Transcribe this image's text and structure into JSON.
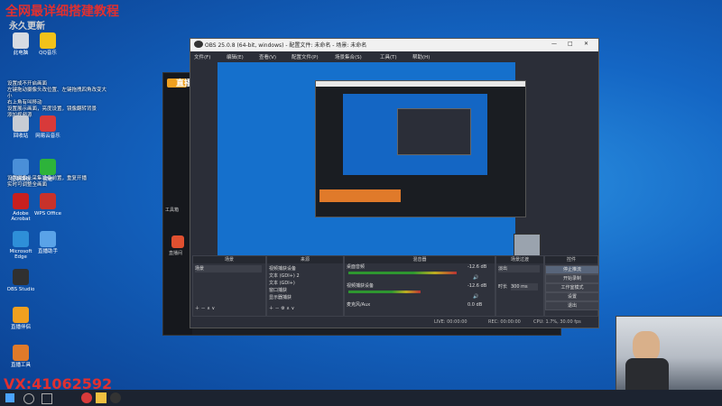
{
  "overlay": {
    "top_left_red": "全网最详细搭建教程",
    "top_left_sub": "永久更新",
    "bottom_left_red": "VX:41062592",
    "notes": [
      "设置成不开启画面",
      "左键拖动摄像头改位置、左键拖拽四角改变大小",
      "右上角有叫移动",
      "设置展示画面，亮度设置，镜像翻转背景",
      "添加视频源"
    ],
    "notes2": [
      "设置摄像头采集设备前置，重复开播",
      "实时可调整全画面"
    ]
  },
  "desktop_icons": [
    {
      "label": "此电脑",
      "color": "#d7dbe2"
    },
    {
      "label": "QQ音乐",
      "color": "#f2c21a"
    },
    {
      "label": "回收站",
      "color": "#c7ccd4"
    },
    {
      "label": "网易云音乐",
      "color": "#d83a3a"
    },
    {
      "label": "控制面板",
      "color": "#4a8fd8"
    },
    {
      "label": "微信",
      "color": "#2db33a"
    },
    {
      "label": "Adobe Acrobat",
      "color": "#c8201f"
    },
    {
      "label": "WPS Office",
      "color": "#c8322a"
    },
    {
      "label": "Microsoft Edge",
      "color": "#2e8fd8"
    },
    {
      "label": "直播助手",
      "color": "#5aa3e8"
    },
    {
      "label": "OBS Studio",
      "color": "#303030"
    },
    {
      "label": "直播伴侣",
      "color": "#f0a020"
    },
    {
      "label": "直播工具",
      "color": "#e07a2a"
    }
  ],
  "obs": {
    "title": "OBS 25.0.8 (64-bit, windows) - 配置文件: 未命名 - 场景: 未命名",
    "menu": [
      "文件(F)",
      "编辑(E)",
      "查看(V)",
      "配置文件(P)",
      "场景集合(S)",
      "工具(T)",
      "帮助(H)"
    ],
    "docks": {
      "scenes": {
        "header": "场景",
        "items": [
          "场景"
        ]
      },
      "sources": {
        "header": "来源",
        "items": [
          "视频捕获设备",
          "文本 (GDI+) 2",
          "文本 (GDI+)",
          "窗口捕获",
          "显示器捕获"
        ]
      },
      "mixer": {
        "header": "混音器",
        "tracks": [
          {
            "name": "桌面音频",
            "db": "-12.6 dB"
          },
          {
            "name": "视频捕获设备",
            "db": "-12.6 dB"
          },
          {
            "name": "麦克风/Aux",
            "db": "0.0 dB"
          }
        ]
      },
      "transitions": {
        "header": "场景过渡",
        "type": "淡出",
        "duration_label": "时长",
        "duration_value": "300 ms"
      },
      "controls": {
        "header": "控件",
        "buttons": [
          "停止推流",
          "开始录制",
          "工作室模式",
          "设置",
          "退出"
        ]
      }
    },
    "status": {
      "live": "LIVE: 00:00:00",
      "rec": "REC: 00:00:00",
      "cpu": "CPU: 1.7%, 30.00 fps"
    }
  },
  "backapp": {
    "title": "直播",
    "label1": "工具箱",
    "label2": "直播间"
  },
  "taskbar": {
    "icons": [
      "start-icon",
      "search-icon",
      "taskview-icon",
      "browser-icon",
      "folder-icon",
      "obs-icon"
    ]
  }
}
